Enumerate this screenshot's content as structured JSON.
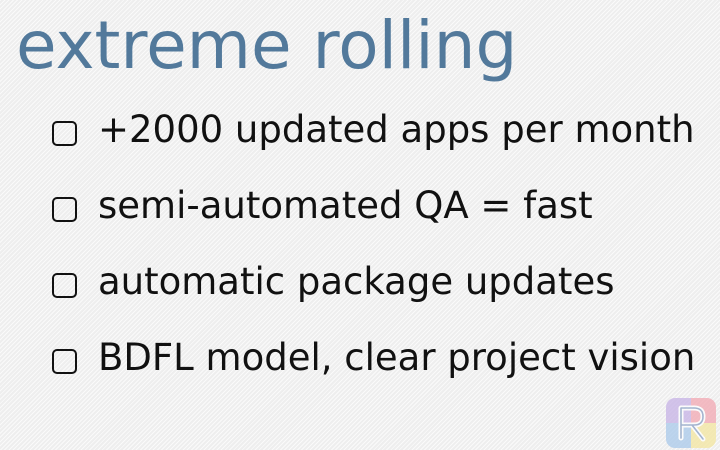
{
  "slide": {
    "title": "extreme rolling",
    "bullets": [
      {
        "text": "+2000 updated apps per month",
        "icon": "checkbox-icon"
      },
      {
        "text": "semi-automated QA = fast",
        "icon": "checkbox-icon"
      },
      {
        "text": "automatic package updates",
        "icon": "checkbox-icon"
      },
      {
        "text": "BDFL model, clear project vision",
        "icon": "checkbox-icon"
      }
    ]
  },
  "logo": {
    "icon": "r-logo-icon",
    "colors": [
      "#c7b3e6",
      "#f2a8b3",
      "#f4e6a0",
      "#a9c9ea"
    ]
  },
  "colors": {
    "title": "#52799b",
    "text": "#111111",
    "background": "#f3f3f3"
  }
}
